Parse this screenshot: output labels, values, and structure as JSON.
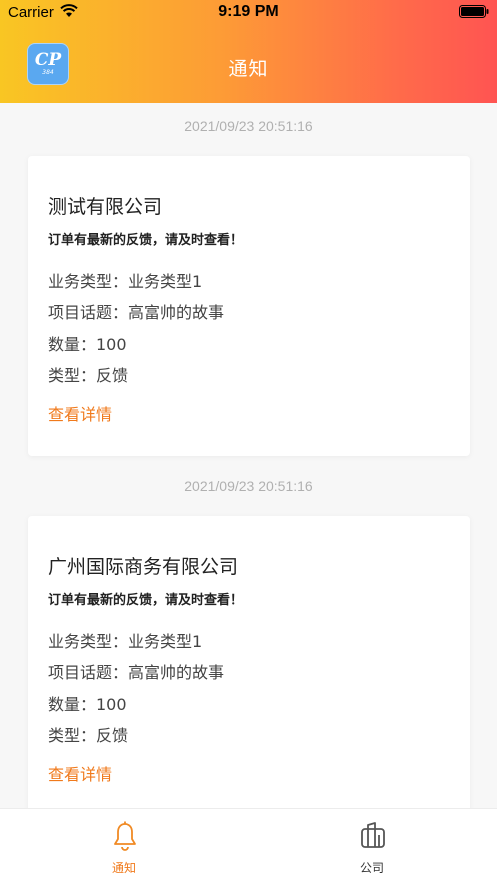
{
  "status_bar": {
    "carrier": "Carrier",
    "time": "9:19 PM"
  },
  "header": {
    "title": "通知",
    "logo_text": "CP",
    "logo_subtext": "384"
  },
  "colors": {
    "accent": "#f07a1c",
    "gradient_start": "#f9c623",
    "gradient_end": "#ff5452",
    "logo_bg": "#5aa8f0"
  },
  "notifications": [
    {
      "timestamp": "2021/09/23 20:51:16",
      "company": "测试有限公司",
      "subtitle": "订单有最新的反馈，请及时查看！",
      "business_type": "业务类型：业务类型1",
      "project_topic": "项目话题：高富帅的故事",
      "quantity": "数量：100",
      "type": "类型：反馈",
      "link": "查看详情"
    },
    {
      "timestamp": "2021/09/23 20:51:16",
      "company": "广州国际商务有限公司",
      "subtitle": "订单有最新的反馈，请及时查看！",
      "business_type": "业务类型：业务类型1",
      "project_topic": "项目话题：高富帅的故事",
      "quantity": "数量：100",
      "type": "类型：反馈",
      "link": "查看详情"
    }
  ],
  "tabs": [
    {
      "label": "通知",
      "icon": "bell-icon",
      "active": true
    },
    {
      "label": "公司",
      "icon": "building-icon",
      "active": false
    }
  ]
}
